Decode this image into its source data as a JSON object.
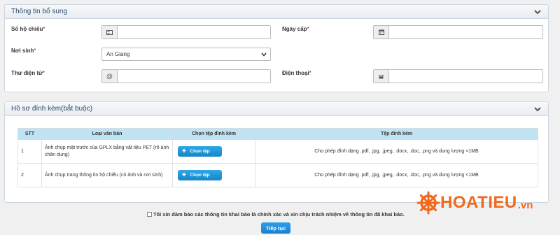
{
  "additional_info": {
    "title": "Thông tin bổ sung",
    "passport_label": "Số hộ chiếu",
    "issue_date_label": "Ngày cấp",
    "birthplace_label": "Nơi sinh",
    "birthplace_value": "An Giang",
    "email_label": "Thư điện tử",
    "email_addon": "@",
    "phone_label": "Điện thoại",
    "required_mark": "*"
  },
  "attachments": {
    "title": "Hồ sơ đính kèm(bắt buộc)",
    "columns": [
      "STT",
      "Loại văn bản",
      "Chọn tệp đính kèm",
      "Tệp đính kèm"
    ],
    "rows": [
      {
        "stt": "1",
        "type": "Ảnh chụp mặt trước của GPLX bằng vật liệu PET (rõ ảnh chân dung)",
        "button": "Chọn tệp",
        "note": "Cho phép đính dạng .pdf, .jpg, .jpeg, .docx, .doc, .png và dung lượng <1MB"
      },
      {
        "stt": "2",
        "type": "Ảnh chụp trang thông tin hộ chiếu (có ảnh và nơi sinh)",
        "button": "Chọn tệp",
        "note": "Cho phép đính dạng .pdf, .jpg, .jpeg, .docx, .doc, .png và dung lượng <1MB"
      }
    ]
  },
  "confirm_text": "Tôi xin đảm bảo các thông tin khai báo là chính xác và xin chịu trách nhiệm về thông tin đã khai báo.",
  "next_button": "Tiếp tục",
  "watermark": {
    "brand": "HOATIEU",
    "suffix": ".vn",
    "color": "#f06a1e"
  }
}
